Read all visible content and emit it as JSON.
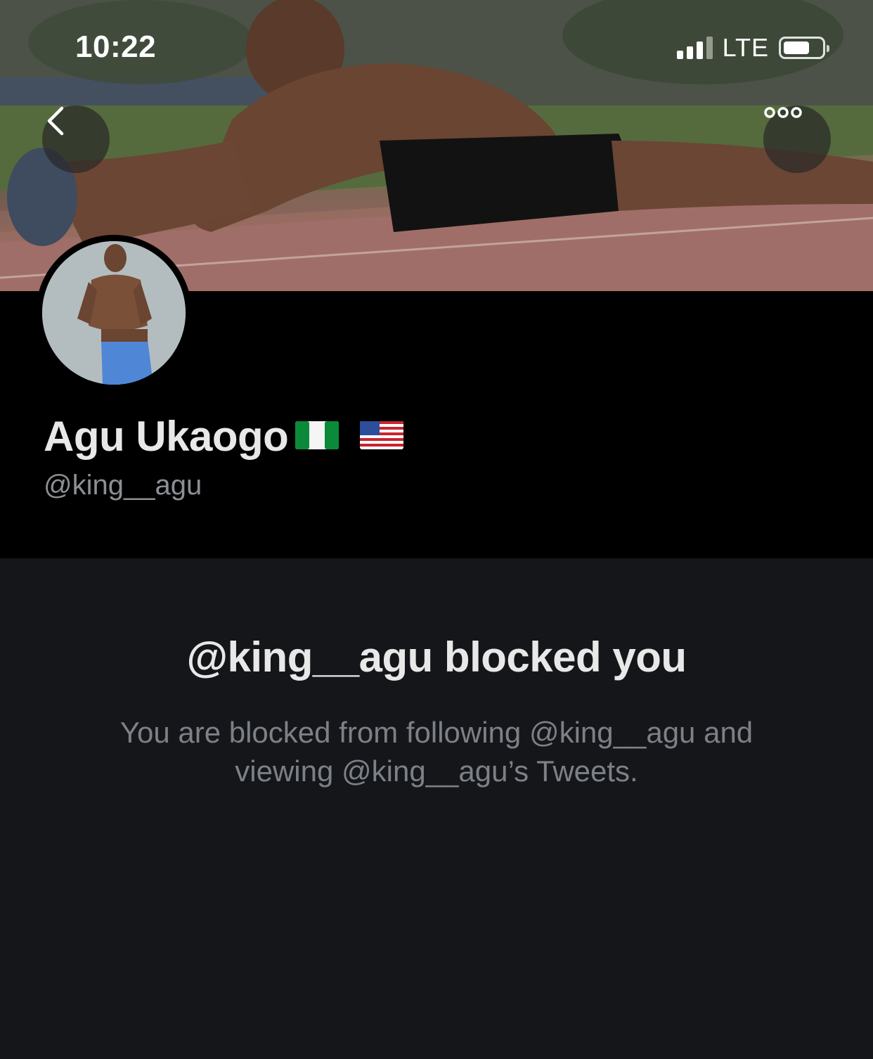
{
  "status_bar": {
    "time": "10:22",
    "network": "LTE",
    "signal_icon": "cellular-signal-icon",
    "battery_icon": "battery-icon"
  },
  "nav": {
    "back_icon": "chevron-left-icon",
    "more_icon": "more-horizontal-icon"
  },
  "profile": {
    "display_name": "Agu Ukaogo",
    "flags": [
      "nigeria-flag-icon",
      "usa-flag-icon"
    ],
    "handle": "@king__agu"
  },
  "blocked": {
    "title": "@king__agu blocked you",
    "body_line1": "You are blocked from following @king__agu and",
    "body_line2": "viewing @king__agu’s Tweets."
  },
  "colors": {
    "header_bg": "#000000",
    "page_bg": "#15161a",
    "primary_text": "#e8e8e8",
    "secondary_text": "#8b8f95"
  }
}
